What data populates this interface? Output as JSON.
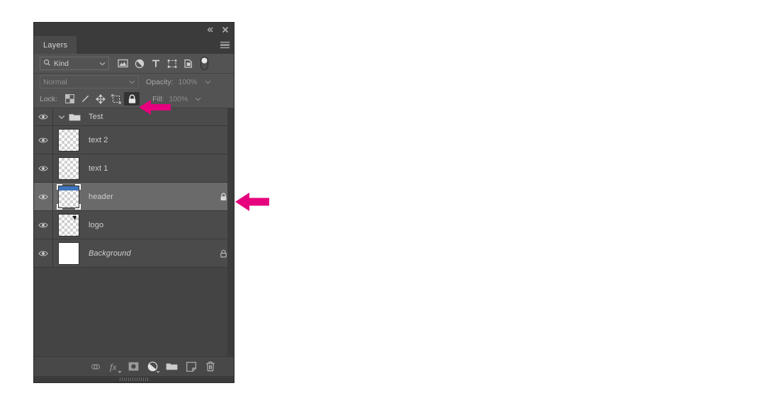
{
  "panel": {
    "title": "Layers",
    "collapse_icon": "double-chevron-left-icon",
    "close_icon": "close-icon",
    "menu_icon": "hamburger-menu-icon"
  },
  "filter": {
    "search_icon": "search-icon",
    "kind_label": "Kind",
    "chevron": "chevron-down-icon",
    "icons": [
      {
        "name": "filter-pixel-icon",
        "title": "Pixel layers"
      },
      {
        "name": "filter-adjustment-icon",
        "title": "Adjustment layers"
      },
      {
        "name": "filter-type-icon",
        "title": "Type layers"
      },
      {
        "name": "filter-shape-icon",
        "title": "Shape layers"
      },
      {
        "name": "filter-smart-object-icon",
        "title": "Smart objects"
      }
    ],
    "toggle": {
      "name": "filter-enable-toggle",
      "state": "off"
    }
  },
  "blend": {
    "mode": "Normal",
    "chevron": "chevron-down-icon",
    "opacity_label": "Opacity:",
    "opacity_value": "100%"
  },
  "lock": {
    "label": "Lock:",
    "buttons": [
      {
        "name": "lock-transparent-pixels-icon",
        "active": false
      },
      {
        "name": "lock-image-pixels-icon",
        "active": false
      },
      {
        "name": "lock-position-icon",
        "active": false
      },
      {
        "name": "lock-artboard-nesting-icon",
        "active": false
      },
      {
        "name": "lock-all-icon",
        "active": true
      }
    ],
    "fill_label": "Fill:",
    "fill_value": "100%"
  },
  "layers": [
    {
      "name": "Test",
      "type": "group",
      "visible": true,
      "expanded": true,
      "locked": false,
      "selected": false,
      "italic": false,
      "thumb": "none"
    },
    {
      "name": "text 2",
      "type": "layer",
      "visible": true,
      "locked": false,
      "selected": false,
      "italic": false,
      "thumb": "transparent"
    },
    {
      "name": "text 1",
      "type": "layer",
      "visible": true,
      "locked": false,
      "selected": false,
      "italic": false,
      "thumb": "transparent"
    },
    {
      "name": "header",
      "type": "layer",
      "visible": true,
      "locked": true,
      "lock_style": "solid",
      "selected": true,
      "italic": false,
      "thumb": "transparent-banded"
    },
    {
      "name": "logo",
      "type": "layer",
      "visible": true,
      "locked": false,
      "selected": false,
      "italic": false,
      "thumb": "transparent-mark"
    },
    {
      "name": "Background",
      "type": "layer",
      "visible": true,
      "locked": true,
      "lock_style": "outline",
      "selected": false,
      "italic": true,
      "thumb": "solid-white"
    }
  ],
  "bottombar": [
    {
      "name": "link-layers-icon"
    },
    {
      "name": "layer-style-fx-icon",
      "has_caret": true
    },
    {
      "name": "add-layer-mask-icon"
    },
    {
      "name": "new-adjustment-layer-icon",
      "has_caret": true
    },
    {
      "name": "new-group-icon"
    },
    {
      "name": "new-layer-icon"
    },
    {
      "name": "delete-layer-icon"
    }
  ],
  "annotations": {
    "color": "#E6007E",
    "arrows": [
      {
        "name": "arrow-pointing-to-lock-all-button",
        "target": "lock-all-icon"
      },
      {
        "name": "arrow-pointing-to-header-layer-row",
        "target": "layer-row-header"
      }
    ]
  }
}
